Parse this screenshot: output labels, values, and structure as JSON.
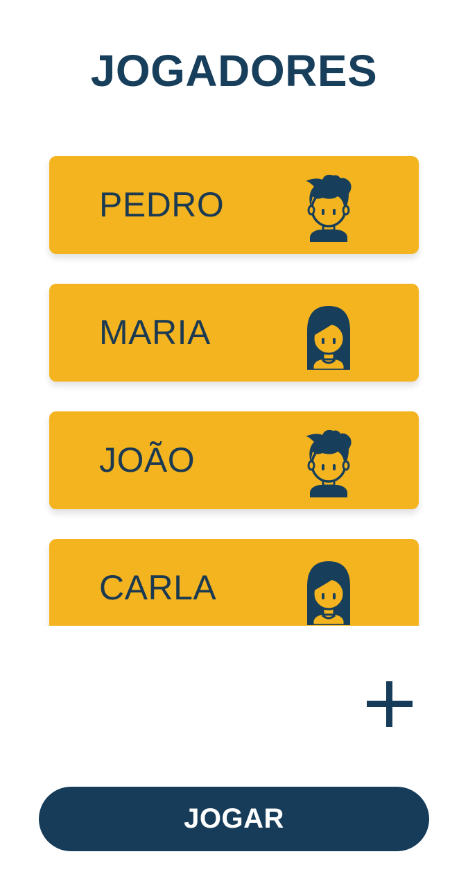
{
  "title": "JOGADORES",
  "players": [
    {
      "name": "PEDRO",
      "avatar": "boy-avatar-icon"
    },
    {
      "name": "MARIA",
      "avatar": "girl-avatar-icon"
    },
    {
      "name": "JOÃO",
      "avatar": "boy-avatar-icon"
    },
    {
      "name": "CARLA",
      "avatar": "girl-avatar-icon"
    }
  ],
  "add_button": {
    "icon": "plus-icon"
  },
  "play_button": {
    "label": "JOGAR"
  },
  "colors": {
    "primary": "#163c59",
    "card": "#f4b41f",
    "background": "#ffffff"
  }
}
